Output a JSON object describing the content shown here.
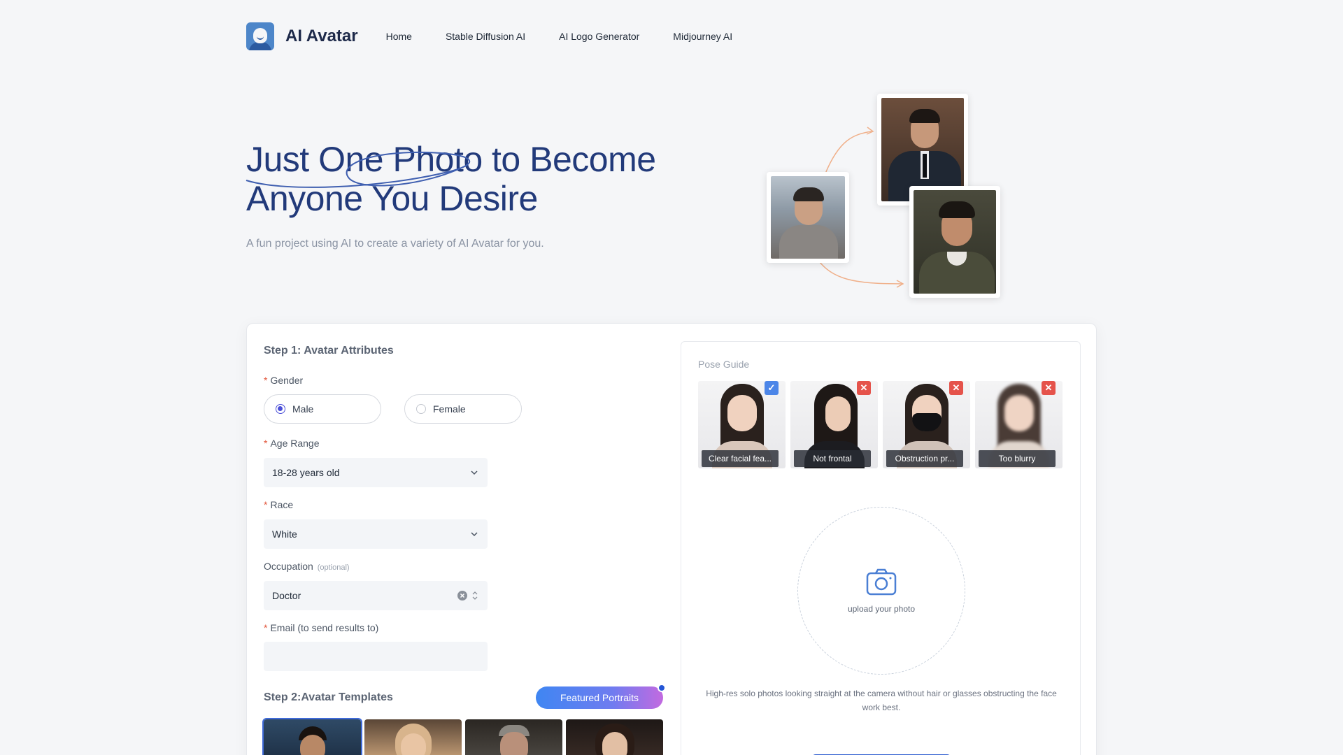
{
  "nav": {
    "brand": "AI Avatar",
    "links": [
      "Home",
      "Stable Diffusion AI",
      "AI Logo Generator",
      "Midjourney AI"
    ]
  },
  "hero": {
    "title_line1": "Just One Photo to Become",
    "title_line2": "Anyone You Desire",
    "subtitle": "A fun project using AI to create a variety of AI Avatar for you."
  },
  "step1": {
    "title": "Step 1: Avatar Attributes",
    "gender_label": "Gender",
    "gender_options": [
      "Male",
      "Female"
    ],
    "gender_selected": "Male",
    "age_label": "Age Range",
    "age_value": "18-28 years old",
    "race_label": "Race",
    "race_value": "White",
    "occupation_label": "Occupation",
    "occupation_optional": "(optional)",
    "occupation_value": "Doctor",
    "email_label": "Email (to send results to)",
    "email_value": ""
  },
  "step2": {
    "title": "Step 2:Avatar Templates",
    "featured_button": "Featured Portraits"
  },
  "pose_guide": {
    "label": "Pose Guide",
    "items": [
      {
        "caption": "Clear facial fea...",
        "status": "ok"
      },
      {
        "caption": "Not frontal",
        "status": "no"
      },
      {
        "caption": "Obstruction pr...",
        "status": "no"
      },
      {
        "caption": "Too blurry",
        "status": "no"
      }
    ],
    "upload_text": "upload your photo",
    "hint": "High-res solo photos looking straight at the camera without hair or glasses obstructing the face work best."
  },
  "colors": {
    "accent": "#4b4fd8",
    "title_blue": "#223a7a",
    "required": "#e2563b"
  }
}
